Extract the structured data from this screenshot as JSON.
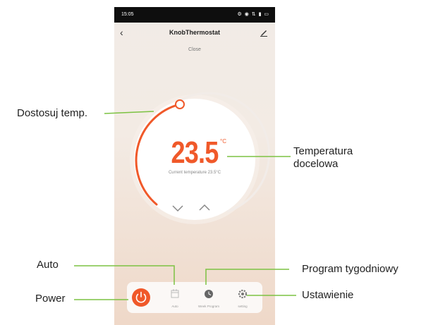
{
  "status_bar": {
    "time": "15:05",
    "icons": "⚙ ◉ ⇅ ▮ ▭"
  },
  "header": {
    "back_icon": "‹",
    "title": "KnobThermostat",
    "subtitle": "Close"
  },
  "dial": {
    "target_temp": "23.5",
    "unit": "°C",
    "current_text": "Current temperature 23.5°C",
    "accent": "#f0592a"
  },
  "toolbar": {
    "items": [
      {
        "label": "",
        "icon": "power-icon"
      },
      {
        "label": "Auto",
        "icon": "auto-icon"
      },
      {
        "label": "Week Program",
        "icon": "clock-icon"
      },
      {
        "label": "setting",
        "icon": "gear-icon"
      }
    ]
  },
  "annotations": {
    "set_temp": "Dostosuj temp.",
    "target_temp": "Temperatura docelowa",
    "target_temp_line1": "Temperatura",
    "target_temp_line2": "docelowa",
    "auto": "Auto",
    "power": "Power",
    "weekly_program": "Program tygodniowy",
    "settings": "Ustawienie",
    "line_color": "#7cc242"
  }
}
